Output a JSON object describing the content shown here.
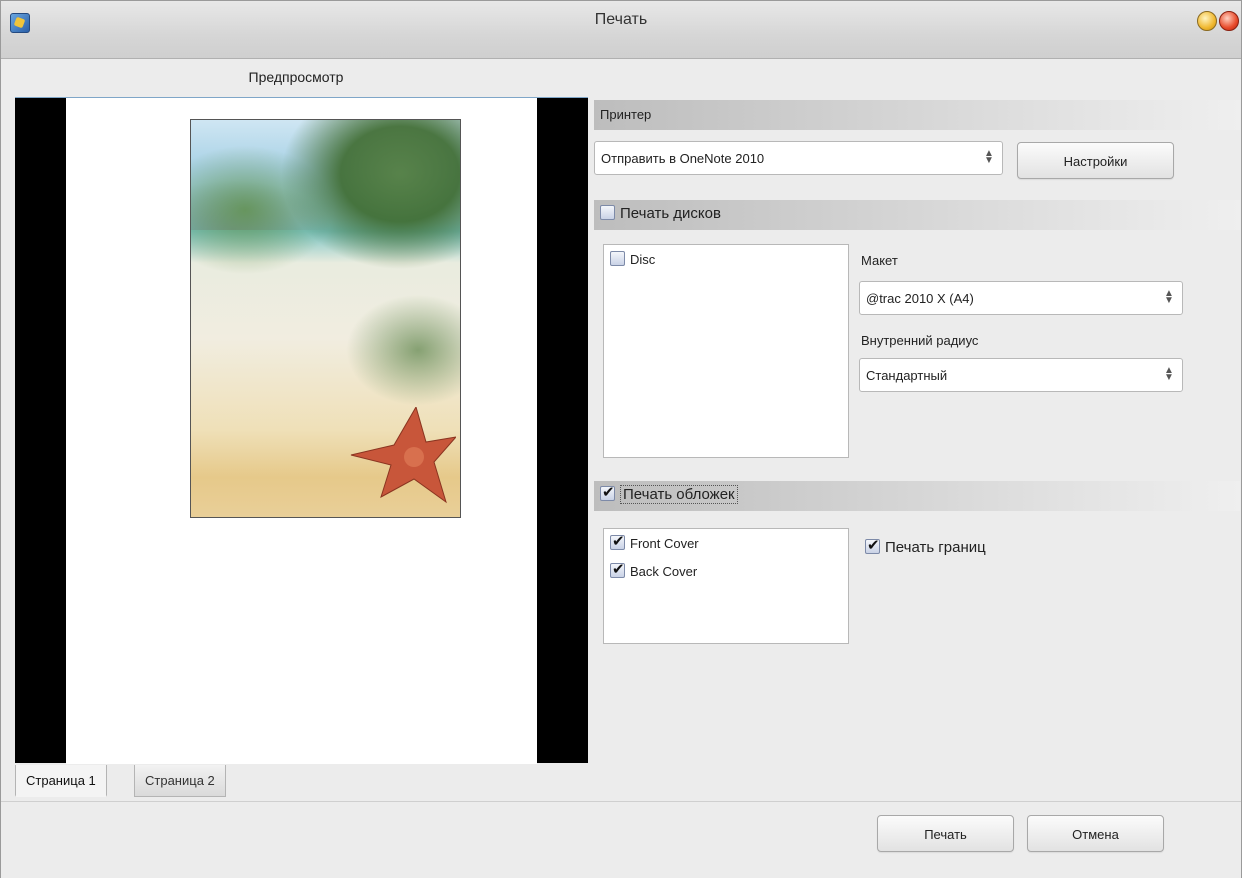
{
  "window": {
    "title": "Печать"
  },
  "preview": {
    "header": "Предпросмотр",
    "tabs": [
      {
        "label": "Страница 1",
        "active": true
      },
      {
        "label": "Страница 2",
        "active": false
      }
    ]
  },
  "printer": {
    "section_label": "Принтер",
    "selected": "Отправить в OneNote 2010",
    "settings_button": "Настройки"
  },
  "discs": {
    "section_label": "Печать дисков",
    "checked": false,
    "items": [
      {
        "label": "Disc",
        "checked": false
      }
    ],
    "layout_label": "Макет",
    "layout_value": "@trac 2010 X (A4)",
    "radius_label": "Внутренний радиус",
    "radius_value": "Стандартный"
  },
  "covers": {
    "section_label": "Печать обложек",
    "checked": true,
    "items": [
      {
        "label": "Front Cover",
        "checked": true
      },
      {
        "label": "Back Cover",
        "checked": true
      }
    ],
    "print_borders_label": "Печать границ",
    "print_borders_checked": true
  },
  "actions": {
    "print_button": "Печать",
    "cancel_button": "Отмена"
  }
}
